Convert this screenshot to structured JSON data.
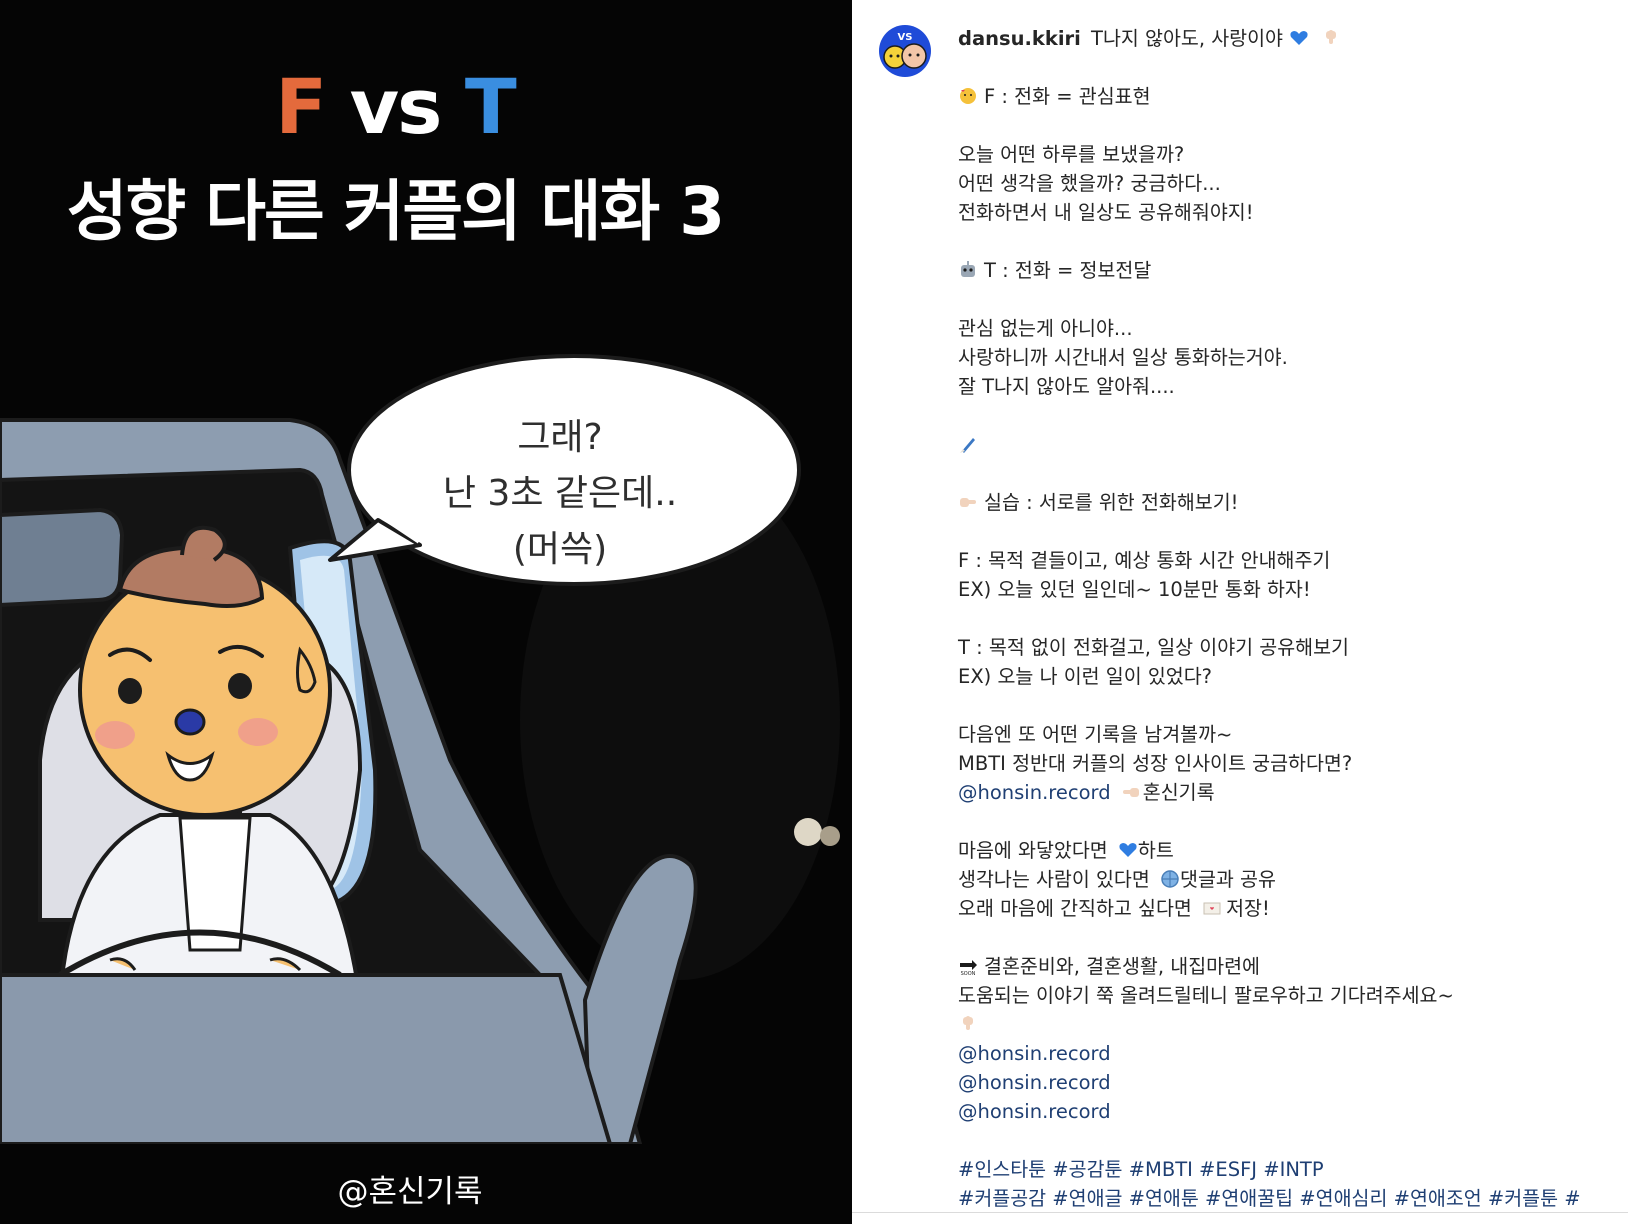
{
  "comic": {
    "title_f": "F",
    "title_vs": "vs",
    "title_t": "T",
    "subtitle": "성향 다른 커플의 대화 3",
    "bubble_lines": [
      "그래?",
      "난 3초 같은데..",
      "(머쓱)"
    ],
    "watermark": "@혼신기록"
  },
  "post": {
    "username": "dansu.kkiri",
    "avatar_badge": "VS",
    "title_text": "T나지 않아도, 사랑이야",
    "lines": {
      "f_head": "F : 전화 = 관심표현",
      "f1": "오늘 어떤 하루를 보냈을까?",
      "f2": "어떤 생각을 했을까? 궁금하다...",
      "f3": "전화하면서 내 일상도 공유해줘야지!",
      "t_head": "T : 전화 = 정보전달",
      "t1": "관심 없는게 아니야...",
      "t2": "사랑하니까 시간내서 일상 통화하는거야.",
      "t3": "잘 T나지 않아도 알아줘....",
      "practice": "실습 : 서로를 위한 전화해보기!",
      "fp1": "F : 목적 곁들이고, 예상 통화 시간 안내해주기",
      "fp2": "EX) 오늘 있던 일인데~ 10분만 통화 하자!",
      "tp1": "T : 목적 없이 전화걸고, 일상 이야기 공유해보기",
      "tp2": "EX) 오늘 나 이런 일이 있었다?",
      "n1": "다음엔 또 어떤 기록을 남겨볼까~",
      "n2": "MBTI 정반대 커플의 성장 인사이트 궁금하다면?",
      "n3_mention": "@honsin.record",
      "n3_rest": "혼신기록",
      "h1_a": "마음에 와닿았다면",
      "h1_b": "하트",
      "h2_a": "생각나는 사람이 있다면",
      "h2_b": "댓글과 공유",
      "h3_a": "오래 마음에 간직하고 싶다면",
      "h3_b": "저장!",
      "s1": "결혼준비와, 결혼생활, 내집마련에",
      "s2": "도움되는 이야기 쭉 올려드릴테니 팔로우하고 기다려주세요~",
      "m1": "@honsin.record",
      "m2": "@honsin.record",
      "m3": "@honsin.record",
      "tags1": "#인스타툰 #공감툰 #MBTI #ESFJ #INTP",
      "tags2": "#커플공감 #연애글 #연애툰 #연애꿀팁 #연애심리 #연애조언 #커플툰 #"
    },
    "emoji_names": [
      "blue-heart",
      "pointing-down",
      "smiling-hearts",
      "robot",
      "paintbrush",
      "pointing-right",
      "pointing-left",
      "blue-heart",
      "globe",
      "love-letter",
      "soon-arrow",
      "pointing-down"
    ]
  }
}
